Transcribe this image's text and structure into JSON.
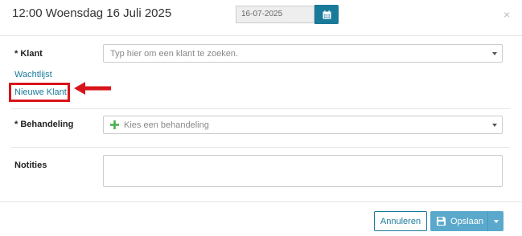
{
  "header": {
    "title": "12:00 Woensdag 16 Juli 2025",
    "date_value": "16-07-2025",
    "close_glyph": "×"
  },
  "form": {
    "klant": {
      "label": "* Klant",
      "placeholder": "Typ hier om een klant te zoeken."
    },
    "links": {
      "wachtlijst": "Wachtlijst",
      "nieuwe_klant": "Nieuwe Klant"
    },
    "behandeling": {
      "label": "* Behandeling",
      "placeholder": "Kies een behandeling"
    },
    "notities": {
      "label": "Notities",
      "value": ""
    }
  },
  "footer": {
    "cancel_label": "Annuleren",
    "save_label": "Opslaan"
  },
  "colors": {
    "accent": "#1a7a9a",
    "save_button": "#5aa9cc",
    "annotation_red": "#d9141b",
    "plus_green": "#4caf50"
  },
  "icons": {
    "calendar": "calendar-icon",
    "close": "close-icon",
    "plus": "plus-icon",
    "save": "floppy-disk-icon",
    "dropdown": "chevron-down-icon",
    "annotation": "red-arrow-icon"
  }
}
